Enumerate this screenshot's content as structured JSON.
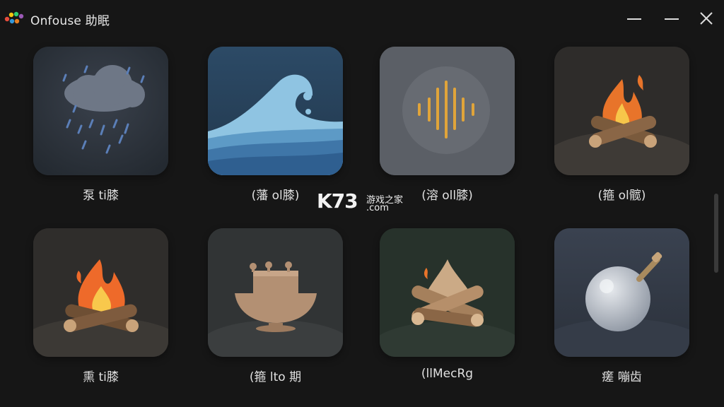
{
  "app": {
    "title": "Onfouse 助眠"
  },
  "window_controls": [
    "minimize",
    "maximize",
    "close"
  ],
  "sounds": [
    {
      "label": "泵 ti膝",
      "icon": "rain-cloud-icon"
    },
    {
      "label": "(藩 ol膝)",
      "icon": "ocean-wave-icon"
    },
    {
      "label": "(溶 oll膝)",
      "icon": "sound-wave-icon"
    },
    {
      "label": "(箍 ol髋)",
      "icon": "campfire-icon"
    },
    {
      "label": "熏 ti膝",
      "icon": "fire-icon"
    },
    {
      "label": "(箍 lto 期",
      "icon": "singing-bowl-icon"
    },
    {
      "label": "(llMecRg",
      "icon": "wood-fire-icon"
    },
    {
      "label": "瘥 嘣齿",
      "icon": "moon-orb-icon"
    }
  ],
  "watermark": {
    "logo": "K73",
    "text": "游戏之家",
    "domain": ".com"
  },
  "colors": {
    "background": "#161616",
    "text": "#e6e6e6"
  }
}
